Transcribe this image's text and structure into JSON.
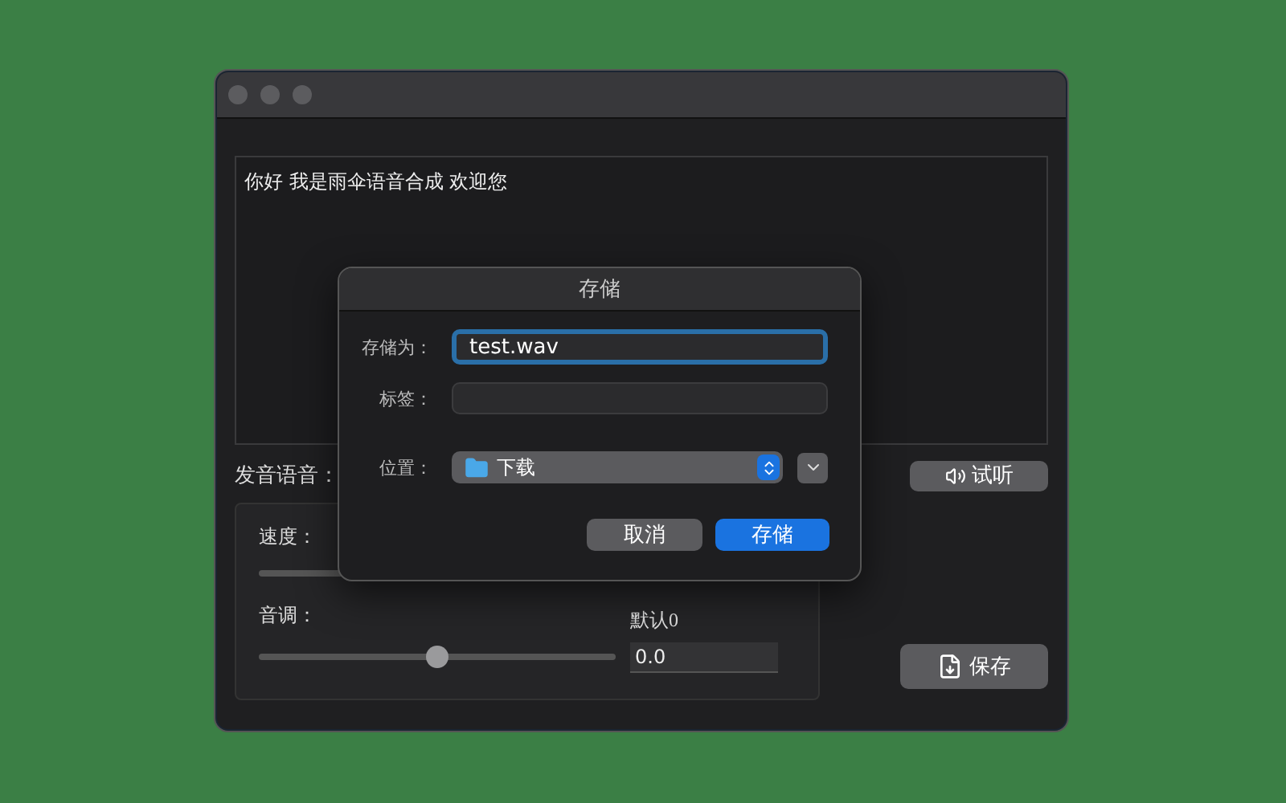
{
  "window": {
    "text_area": {
      "value": "你好 我是雨伞语音合成 欢迎您"
    },
    "voice_label": "发音语音：",
    "preview_button": "试听",
    "speed": {
      "label": "速度："
    },
    "pitch": {
      "label": "音调：",
      "level": 0.5,
      "hint": "默认0",
      "value": "0.0"
    },
    "save_button": "保存"
  },
  "dialog": {
    "title": "存储",
    "save_as": {
      "label": "存储为：",
      "value": "test.wav",
      "focused": true
    },
    "tags": {
      "label": "标签："
    },
    "location": {
      "label": "位置：",
      "value": "下载"
    },
    "buttons": [
      {
        "label": "取消",
        "primary": false
      },
      {
        "label": "存储",
        "primary": true
      }
    ]
  }
}
